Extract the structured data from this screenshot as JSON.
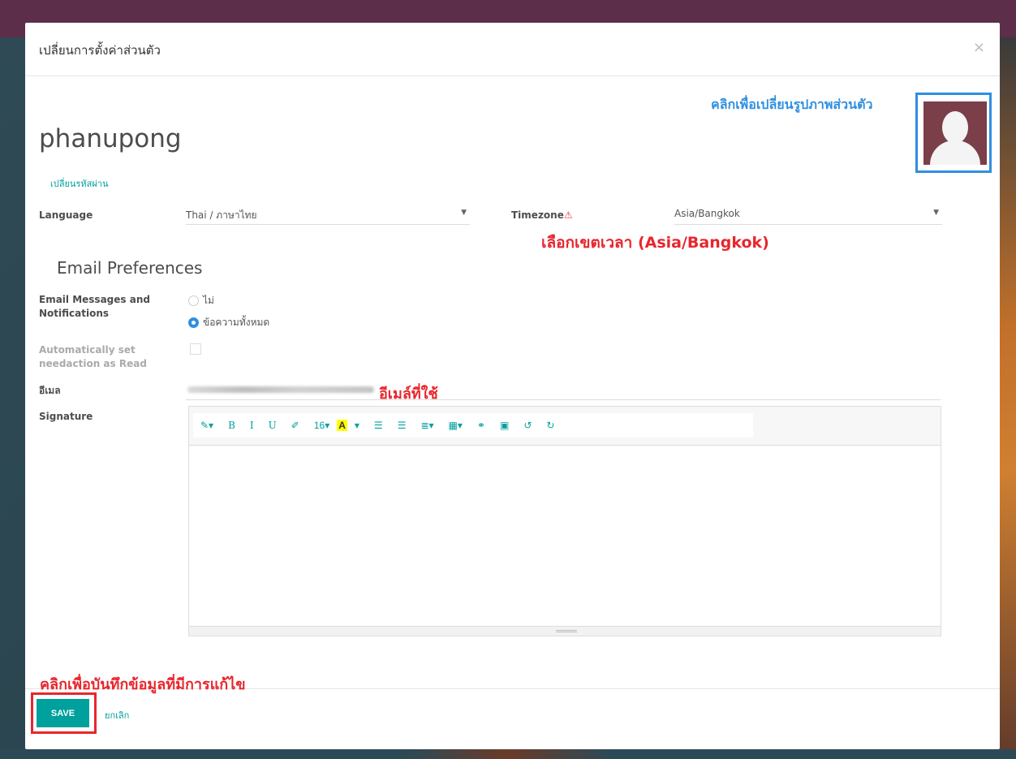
{
  "dialog": {
    "title": "เปลี่ยนการตั้งค่าส่วนตัว",
    "close_glyph": "×"
  },
  "profile": {
    "username": "phanupong",
    "change_password": "เปลี่ยนรหัสผ่าน",
    "avatar_annotation": "คลิกเพื่อเปลี่ยนรูปภาพส่วนตัว"
  },
  "fields": {
    "language_label": "Language",
    "language_value": "Thai / ภาษาไทย",
    "timezone_label": "Timezone",
    "timezone_warning": "⚠",
    "timezone_value": "Asia/Bangkok",
    "timezone_annotation": "เลือกเขตเวลา (Asia/Bangkok)"
  },
  "email_prefs": {
    "section_title": "Email Preferences",
    "messages_label_line1": "Email Messages and",
    "messages_label_line2": "Notifications",
    "option_never": "ไม่",
    "option_all": "ข้อความทั้งหมด",
    "auto_read_line1": "Automatically set",
    "auto_read_line2": "needaction as Read",
    "auto_read_checked": false,
    "email_label": "อีเมล",
    "email_annotation": "อีเมล์ที่ใช้",
    "signature_label": "Signature"
  },
  "editor_toolbar": [
    {
      "name": "pen-icon",
      "glyph": "✎▾",
      "sans": true
    },
    {
      "name": "bold-button",
      "glyph": "B",
      "sans": false
    },
    {
      "name": "italic-button",
      "glyph": "I",
      "sans": false
    },
    {
      "name": "underline-button",
      "glyph": "U",
      "sans": false
    },
    {
      "name": "eraser-icon",
      "glyph": "✐",
      "sans": true
    },
    {
      "name": "font-size-dropdown",
      "glyph": "16▾",
      "sans": true
    },
    {
      "name": "font-color-dropdown",
      "glyph": "A",
      "sans": true,
      "hilite": true
    },
    {
      "name": "font-color-caret",
      "glyph": "▾",
      "sans": true
    },
    {
      "name": "unordered-list-icon",
      "glyph": "☰",
      "sans": true
    },
    {
      "name": "ordered-list-icon",
      "glyph": "☰",
      "sans": true
    },
    {
      "name": "paragraph-dropdown",
      "glyph": "≣▾",
      "sans": true
    },
    {
      "name": "table-dropdown",
      "glyph": "▦▾",
      "sans": true
    },
    {
      "name": "link-icon",
      "glyph": "⚭",
      "sans": true
    },
    {
      "name": "image-icon",
      "glyph": "▣",
      "sans": true
    },
    {
      "name": "undo-icon",
      "glyph": "↺",
      "sans": true
    },
    {
      "name": "redo-icon",
      "glyph": "↻",
      "sans": true
    }
  ],
  "footer": {
    "save_annotation": "คลิกเพื่อบันทึกข้อมูลที่มีการแก้ไข",
    "save_label": "SAVE",
    "cancel_label": "ยกเลิก"
  },
  "colors": {
    "accent": "#00a09d",
    "annotation_red": "#e8262d",
    "annotation_blue": "#2f8fe0",
    "topbar": "#5c2e4a"
  }
}
